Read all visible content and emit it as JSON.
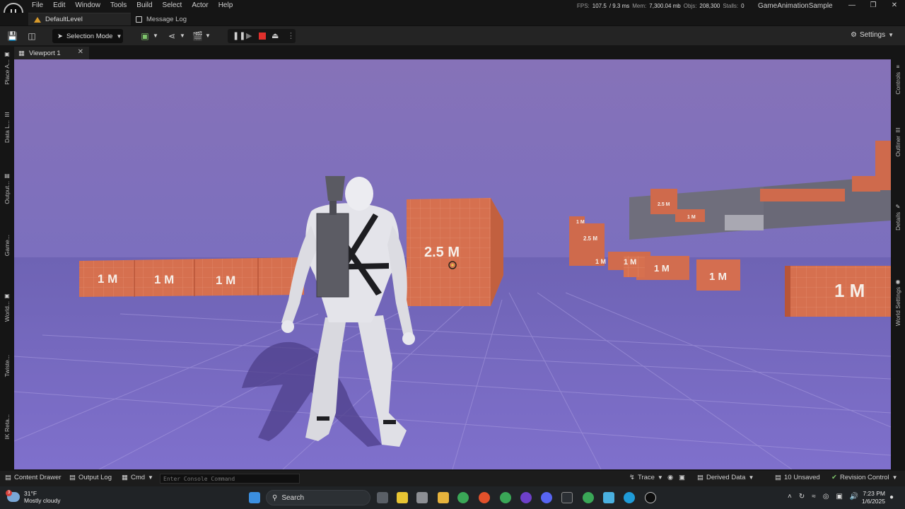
{
  "menu": [
    "File",
    "Edit",
    "Window",
    "Tools",
    "Build",
    "Select",
    "Actor",
    "Help"
  ],
  "stats": {
    "fps_label": "FPS:",
    "fps": "107.5",
    "ms": "/ 9.3 ms",
    "mem_label": "Mem:",
    "mem": "7,300.04 mb",
    "objs_label": "Objs:",
    "objs": "208,300",
    "stalls_label": "Stalls:",
    "stalls": "0"
  },
  "project_name": "GameAnimationSample",
  "level_tabs": {
    "default": "DefaultLevel",
    "message_log": "Message Log"
  },
  "toolbar": {
    "selection_mode": "Selection Mode",
    "settings": "Settings"
  },
  "viewport": {
    "tab_label": "Viewport 1",
    "crate_labels": {
      "center": "2.5 M",
      "left": [
        "1 M",
        "1 M",
        "1 M"
      ],
      "right": [
        "1 M",
        "1 M",
        "1 M",
        "1 M"
      ],
      "far": [
        "1 M",
        "2.5 M",
        "1 M",
        "2.5 M",
        "1 M"
      ]
    }
  },
  "left_rail": [
    "Place A...",
    "Data L...",
    "Output...",
    "Game...",
    "World...",
    "Twiste...",
    "IK Reta..."
  ],
  "right_rail": [
    "Controls",
    "Outliner",
    "Details",
    "World Settings"
  ],
  "statusbar": {
    "content_drawer": "Content Drawer",
    "output_log": "Output Log",
    "cmd": "Cmd",
    "console_placeholder": "Enter Console Command",
    "trace": "Trace",
    "derived_data": "Derived Data",
    "unsaved": "10 Unsaved",
    "revision_control": "Revision Control"
  },
  "taskbar": {
    "weather_temp": "31°F",
    "weather_desc": "Mostly cloudy",
    "weather_badge": "3",
    "search_placeholder": "Search",
    "time": "7:23 PM",
    "date": "1/6/2025"
  },
  "colors": {
    "sky": "#7e6db8",
    "floor": "#7666bf",
    "crate": "#d56d4e",
    "crate_dark": "#b85538",
    "grey_block": "#6f6f78",
    "editor_bg": "#151515",
    "panel_bg": "#242424",
    "stop_red": "#e0302c",
    "warning_orange": "#d89a2b"
  }
}
